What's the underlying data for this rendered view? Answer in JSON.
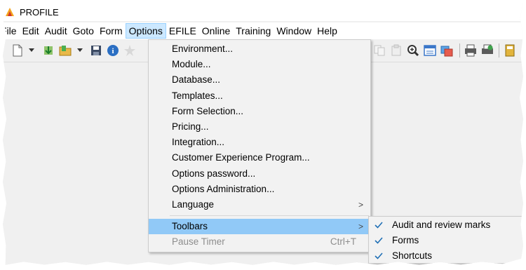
{
  "window": {
    "title": "PROFILE"
  },
  "menubar": {
    "items": [
      "File",
      "Edit",
      "Audit",
      "Goto",
      "Form",
      "Options",
      "EFILE",
      "Online",
      "Training",
      "Window",
      "Help"
    ]
  },
  "options_menu": {
    "items": [
      {
        "label": "Environment..."
      },
      {
        "label": "Module..."
      },
      {
        "label": "Database..."
      },
      {
        "label": "Templates..."
      },
      {
        "label": "Form Selection..."
      },
      {
        "label": "Pricing..."
      },
      {
        "label": "Integration..."
      },
      {
        "label": "Customer Experience Program..."
      },
      {
        "label": "Options password..."
      },
      {
        "label": "Options Administration..."
      },
      {
        "label": "Language",
        "submenu_arrow": ">"
      }
    ],
    "toolbars": {
      "label": "Toolbars",
      "submenu_arrow": ">"
    },
    "pause_timer": {
      "label": "Pause Timer",
      "shortcut": "Ctrl+T",
      "disabled": true
    }
  },
  "toolbars_submenu": {
    "items": [
      {
        "label": "Audit and review marks",
        "checked": true
      },
      {
        "label": "Forms",
        "checked": true
      },
      {
        "label": "Shortcuts",
        "checked": true
      }
    ]
  },
  "toolbar": {
    "left_icons": [
      "new-document-icon",
      "import-icon",
      "open-folder-icon",
      "save-icon",
      "info-icon",
      "star-icon"
    ],
    "right_icons": [
      "copy-icon",
      "paste-icon",
      "zoom-icon",
      "form-view-icon",
      "switch-icon",
      "print-icon",
      "print-preview-icon",
      "calculator-icon"
    ]
  },
  "colors": {
    "highlight": "#91c9f7",
    "menubar_active": "#cce8ff",
    "check": "#1f6fb5"
  }
}
